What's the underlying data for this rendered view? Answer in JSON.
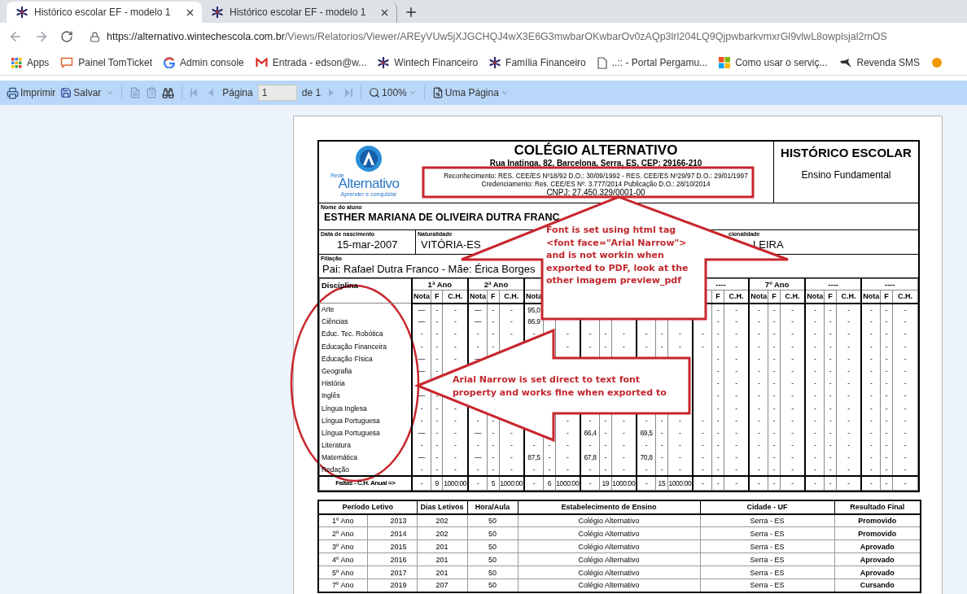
{
  "browser": {
    "tabs": [
      {
        "title": "Histórico escolar EF - modelo 1",
        "selected": true
      },
      {
        "title": "Histórico escolar EF - modelo 1",
        "selected": false
      }
    ],
    "url_host": "https://alternativo.wintechescola.com.br",
    "url_path": "/Views/Relatorios/Viewer/AREyVUw5jXJGCHQJ4wX3E6G3mwbarOKwbarOv0zAQp3lrl204LQ9QjpwbarkvmxrGl9vlwL8owplsjal2mOS",
    "bookmarks": [
      {
        "kind": "grid",
        "label": "Apps"
      },
      {
        "kind": "bubble",
        "label": "Painel TomTicket"
      },
      {
        "kind": "ring",
        "label": "Admin console"
      },
      {
        "kind": "envelope",
        "label": "Entrada - edson@w..."
      },
      {
        "kind": "asterisk",
        "label": "Wintech Financeiro"
      },
      {
        "kind": "asterisk",
        "label": "Família Financeiro"
      },
      {
        "kind": "document",
        "label": "..:: - Portal Pergamu..."
      },
      {
        "kind": "squares",
        "label": "Como usar o serviç..."
      },
      {
        "kind": "bird",
        "label": "Revenda SMS"
      },
      {
        "kind": "circle"
      }
    ]
  },
  "toolbar": {
    "print": "Imprimir",
    "save": "Salvar",
    "page_label": "Página",
    "page_value": "1",
    "page_of": "de 1",
    "zoom": "100%",
    "view": "Uma Página",
    "navigation_disabled": true
  },
  "report": {
    "logo": {
      "small": "Rede",
      "name": "Alternativo",
      "tagline": "Aprender e conquistar"
    },
    "school": "COLÉGIO ALTERNATIVO",
    "address": "Rua Inatinga, 82, Barcelona, Serra, ES, CEP: 29166-210",
    "recognition": "Reconhecimento: RES. CEE/ES Nº18/92 D.O.: 30/09/1992 - RES. CEE/ES Nº29/97 D.O.: 29/01/1997",
    "accreditation": "Credenciamento: Res. CEE/ES Nº. 3.777/2014 Publicação D.O.: 28/10/2014",
    "cnpj": "CNPJ: 27.450.329/0001-00",
    "doc_title": "HISTÓRICO ESCOLAR",
    "doc_subtitle": "Ensino Fundamental",
    "student": {
      "label": "Nome do aluno",
      "value": "ESTHER MARIANA DE OLIVEIRA DUTRA FRANC"
    },
    "birth": {
      "label": "Data de nascimento",
      "value": "15-mar-2007"
    },
    "birthplace": {
      "label": "Naturalidade",
      "value": "VITÓRIA-ES"
    },
    "nationality": {
      "label": "cionalidade",
      "value": "LEIRA"
    },
    "parents": {
      "label": "Filiação",
      "value": "Pai: Rafael Dutra Franco - Mãe: Érica Borges"
    }
  },
  "grades": {
    "subject_header": "Disciplina",
    "groups": [
      {
        "kind": "year",
        "title": "1ª Ano",
        "subheaders": {
          "nota": "Nota",
          "f": "F",
          "ch": "C.H."
        }
      },
      {
        "kind": "year",
        "title": "2ª Ano",
        "subheaders": {
          "nota": "Nota",
          "f": "F",
          "ch": "C.H."
        }
      },
      {
        "kind": "year",
        "subheaders": {
          "nota": "Nota"
        }
      },
      {
        "kind": "covered"
      },
      {
        "kind": "covered"
      },
      {
        "kind": "year",
        "title": "----",
        "subheaders": {
          "f": "F",
          "ch": "C.H."
        }
      },
      {
        "kind": "year",
        "title": "7º Ano",
        "subheaders": {
          "nota": "Nota",
          "f": "F",
          "ch": "C.H."
        }
      },
      {
        "kind": "year",
        "title": "----",
        "subheaders": {
          "nota": "Nota",
          "f": "F",
          "ch": "C.H."
        }
      },
      {
        "kind": "year",
        "title": "----",
        "subheaders": {
          "nota": "Nota",
          "f": "F",
          "ch": "C.H."
        }
      }
    ],
    "rows": [
      {
        "subject": "Arte",
        "cells": [
          {
            "text": "—"
          },
          {
            "text": "-"
          },
          {
            "text": "-"
          },
          {
            "text": "—"
          },
          {
            "text": "-"
          },
          {
            "text": "-"
          },
          {
            "text": "95,0"
          },
          {},
          {},
          {},
          {},
          {},
          {},
          {},
          {},
          {},
          {
            "text": "-"
          },
          {
            "text": "-"
          },
          {
            "text": "-"
          },
          {
            "text": "-"
          },
          {
            "text": "-"
          },
          {
            "text": "-"
          },
          {
            "text": "-"
          },
          {
            "text": "-"
          },
          {
            "text": "-"
          },
          {
            "text": "-"
          },
          {
            "text": "-"
          }
        ]
      },
      {
        "subject": "Ciências",
        "cells": [
          {
            "text": "—"
          },
          {
            "text": "-"
          },
          {
            "text": "-"
          },
          {
            "text": "—"
          },
          {
            "text": "-"
          },
          {
            "text": "-"
          },
          {
            "text": "86,9"
          },
          {},
          {},
          {},
          {},
          {},
          {},
          {},
          {},
          {},
          {
            "text": "-"
          },
          {
            "text": "-"
          },
          {
            "text": "-"
          },
          {
            "text": "-"
          },
          {
            "text": "-"
          },
          {
            "text": "-"
          },
          {
            "text": "-"
          },
          {
            "text": "-"
          },
          {
            "text": "-"
          },
          {
            "text": "-"
          },
          {
            "text": "-"
          }
        ]
      },
      {
        "subject": "Educ. Tec. Robótica",
        "cells": [
          {
            "text": "-"
          },
          {
            "text": "-"
          },
          {
            "text": "-"
          },
          {
            "text": "-"
          },
          {
            "text": "-"
          },
          {
            "text": "-"
          },
          {
            "text": "-"
          },
          {},
          {
            "text": "-"
          },
          {
            "text": "-"
          },
          {
            "text": "-"
          },
          {
            "text": "-"
          },
          {
            "text": "-"
          },
          {
            "text": "-"
          },
          {
            "text": "-"
          },
          {
            "text": "-"
          },
          {
            "text": "-"
          },
          {
            "text": "-"
          },
          {
            "text": "-"
          },
          {
            "text": "-"
          },
          {
            "text": "-"
          },
          {
            "text": "-"
          },
          {
            "text": "-"
          },
          {
            "text": "-"
          },
          {
            "text": "-"
          },
          {
            "text": "-"
          },
          {
            "text": "-"
          }
        ]
      },
      {
        "subject": "Educação Financeira",
        "cells": [
          {
            "text": "-"
          },
          {
            "text": "-"
          },
          {
            "text": "-"
          },
          {
            "text": "-"
          },
          {
            "text": "-"
          },
          {},
          {},
          {},
          {
            "text": "-"
          },
          {
            "text": "-"
          },
          {
            "text": "-"
          },
          {
            "text": "-"
          },
          {
            "text": "-"
          },
          {
            "text": "-"
          },
          {
            "text": "-"
          },
          {
            "text": "-"
          },
          {
            "text": "-"
          },
          {
            "text": "-"
          },
          {
            "text": "-"
          },
          {
            "text": "-"
          },
          {
            "text": "-"
          },
          {
            "text": "-"
          },
          {
            "text": "-"
          },
          {
            "text": "-"
          },
          {
            "text": "-"
          },
          {
            "text": "-"
          },
          {
            "text": "-"
          }
        ]
      },
      {
        "subject": "Educação Física",
        "cells": [
          {
            "text": "—"
          },
          {
            "text": "-"
          },
          {
            "text": "-"
          },
          {
            "text": "—"
          },
          {},
          {},
          {},
          {},
          {},
          {},
          {},
          {},
          {},
          {},
          {},
          {},
          {
            "text": "-"
          },
          {
            "text": "-"
          },
          {
            "text": "-"
          },
          {
            "text": "-"
          },
          {
            "text": "-"
          },
          {
            "text": "-"
          },
          {
            "text": "-"
          },
          {
            "text": "-"
          },
          {
            "text": "-"
          },
          {
            "text": "-"
          },
          {
            "text": "-"
          }
        ]
      },
      {
        "subject": "Geografia",
        "cells": [
          {
            "text": "—"
          },
          {
            "text": "-"
          },
          {},
          {},
          {},
          {},
          {},
          {},
          {},
          {},
          {},
          {},
          {},
          {},
          {},
          {},
          {
            "text": "-"
          },
          {
            "text": "-"
          },
          {
            "text": "-"
          },
          {
            "text": "-"
          },
          {
            "text": "-"
          },
          {
            "text": "-"
          },
          {
            "text": "-"
          },
          {
            "text": "-"
          },
          {
            "text": "-"
          },
          {
            "text": "-"
          },
          {
            "text": "-"
          }
        ]
      },
      {
        "subject": "História",
        "cells": [
          {},
          {},
          {},
          {},
          {},
          {},
          {},
          {},
          {},
          {},
          {},
          {},
          {},
          {},
          {},
          {},
          {
            "text": "-"
          },
          {
            "text": "-"
          },
          {
            "text": "-"
          },
          {
            "text": "-"
          },
          {
            "text": "-"
          },
          {
            "text": "-"
          },
          {
            "text": "-"
          },
          {
            "text": "-"
          },
          {
            "text": "-"
          },
          {
            "text": "-"
          },
          {
            "text": "-"
          }
        ]
      },
      {
        "subject": "Inglês",
        "cells": [
          {
            "text": "—"
          },
          {
            "text": "-"
          },
          {},
          {},
          {},
          {},
          {},
          {},
          {},
          {},
          {},
          {},
          {},
          {},
          {},
          {},
          {
            "text": "-"
          },
          {
            "text": "-"
          },
          {
            "text": "-"
          },
          {
            "text": "-"
          },
          {
            "text": "-"
          },
          {
            "text": "-"
          },
          {
            "text": "-"
          },
          {
            "text": "-"
          },
          {
            "text": "-"
          },
          {
            "text": "-"
          },
          {
            "text": "-"
          }
        ]
      },
      {
        "subject": "Língua Inglesa",
        "cells": [
          {
            "text": "-"
          },
          {
            "text": "-"
          },
          {
            "text": "-"
          },
          {},
          {},
          {},
          {},
          {},
          {},
          {},
          {},
          {},
          {},
          {},
          {},
          {},
          {
            "text": "-"
          },
          {
            "text": "-"
          },
          {
            "text": "-"
          },
          {
            "text": "-"
          },
          {
            "text": "-"
          },
          {
            "text": "-"
          },
          {
            "text": "-"
          },
          {
            "text": "-"
          },
          {
            "text": "-"
          },
          {
            "text": "-"
          },
          {
            "text": "-"
          }
        ]
      },
      {
        "subject": "Língua Portuguesa",
        "cells": [
          {
            "text": "-"
          },
          {
            "text": "-"
          },
          {
            "text": "-"
          },
          {
            "text": "-"
          },
          {
            "text": "-"
          },
          {},
          {},
          {},
          {
            "text": "-"
          },
          {
            "text": "-"
          },
          {
            "text": "-"
          },
          {
            "text": "-"
          },
          {
            "text": "-"
          },
          {
            "text": "-"
          },
          {
            "text": "-"
          },
          {
            "text": "-"
          },
          {
            "text": "-"
          },
          {
            "text": "-"
          },
          {
            "text": "-"
          },
          {
            "text": "-"
          },
          {
            "text": "-"
          },
          {
            "text": "-"
          },
          {
            "text": "-"
          },
          {
            "text": "-"
          },
          {
            "text": "-"
          },
          {
            "text": "-"
          },
          {
            "text": "-"
          }
        ]
      },
      {
        "subject": "Língua Portuguesa",
        "cells": [
          {
            "text": "—"
          },
          {
            "text": "-"
          },
          {
            "text": "-"
          },
          {
            "text": "—"
          },
          {
            "text": "-"
          },
          {
            "text": "-"
          },
          {},
          {},
          {
            "text": "-"
          },
          {
            "text": "66,4"
          },
          {
            "text": "-"
          },
          {
            "text": "-"
          },
          {
            "text": "69,5"
          },
          {
            "text": "-"
          },
          {
            "text": "-"
          },
          {
            "text": "-"
          },
          {
            "text": "-"
          },
          {
            "text": "-"
          },
          {
            "text": "-"
          },
          {
            "text": "-"
          },
          {
            "text": "-"
          },
          {
            "text": "-"
          },
          {
            "text": "-"
          },
          {
            "text": "-"
          },
          {
            "text": "-"
          },
          {
            "text": "-"
          },
          {
            "text": "-"
          }
        ]
      },
      {
        "subject": "Literatura",
        "cells": [
          {
            "text": "-"
          },
          {
            "text": "-"
          },
          {
            "text": "-"
          },
          {
            "text": "-"
          },
          {
            "text": "-"
          },
          {
            "text": "-"
          },
          {
            "text": "-"
          },
          {
            "text": "-"
          },
          {
            "text": "-"
          },
          {
            "text": "-"
          },
          {
            "text": "-"
          },
          {
            "text": "-"
          },
          {
            "text": "-"
          },
          {
            "text": "-"
          },
          {
            "text": "-"
          },
          {
            "text": "-"
          },
          {
            "text": "-"
          },
          {
            "text": "-"
          },
          {
            "text": "-"
          },
          {
            "text": "-"
          },
          {
            "text": "-"
          },
          {
            "text": "-"
          },
          {
            "text": "-"
          },
          {
            "text": "-"
          },
          {
            "text": "-"
          },
          {
            "text": "-"
          },
          {
            "text": "-"
          }
        ]
      },
      {
        "subject": "Matemática",
        "cells": [
          {
            "text": "—"
          },
          {
            "text": "-"
          },
          {
            "text": "-"
          },
          {
            "text": "—"
          },
          {
            "text": "-"
          },
          {
            "text": "-"
          },
          {
            "text": "87,5"
          },
          {
            "text": "-"
          },
          {
            "text": "-"
          },
          {
            "text": "67,8"
          },
          {
            "text": "-"
          },
          {
            "text": "-"
          },
          {
            "text": "70,8"
          },
          {
            "text": "-"
          },
          {
            "text": "-"
          },
          {
            "text": "-"
          },
          {
            "text": "-"
          },
          {
            "text": "-"
          },
          {
            "text": "-"
          },
          {
            "text": "-"
          },
          {
            "text": "-"
          },
          {
            "text": "-"
          },
          {
            "text": "-"
          },
          {
            "text": "-"
          },
          {
            "text": "-"
          },
          {
            "text": "-"
          },
          {
            "text": "-"
          }
        ]
      },
      {
        "subject": "Redação",
        "cells": [
          {
            "text": "-"
          },
          {
            "text": "-"
          },
          {
            "text": "-"
          },
          {
            "text": "-"
          },
          {
            "text": "-"
          },
          {
            "text": "-"
          },
          {
            "text": "-"
          },
          {
            "text": "-"
          },
          {
            "text": "-"
          },
          {
            "text": "-"
          },
          {
            "text": "-"
          },
          {
            "text": "-"
          },
          {
            "text": "-"
          },
          {
            "text": "-"
          },
          {
            "text": "-"
          },
          {
            "text": "-"
          },
          {
            "text": "-"
          },
          {
            "text": "-"
          },
          {
            "text": "-"
          },
          {
            "text": "-"
          },
          {
            "text": "-"
          },
          {
            "text": "-"
          },
          {
            "text": "-"
          },
          {
            "text": "-"
          },
          {
            "text": "-"
          },
          {
            "text": "-"
          },
          {
            "text": "-"
          }
        ]
      }
    ],
    "totals": {
      "label": "Faltas - C.H. Anual =>",
      "cells": [
        "-",
        "9",
        "1000:00",
        "-",
        "5",
        "1000:00",
        "-",
        "6",
        "1000:00",
        "-",
        "19",
        "1000:00",
        "-",
        "15",
        "1000:00",
        "-",
        "-",
        "-",
        "-",
        "-",
        "-",
        "-",
        "-",
        "-",
        "-",
        "-",
        "-"
      ]
    }
  },
  "periods": {
    "columns": [
      "Período Letivo",
      "Dias Letivos",
      "Hora/Aula",
      "Estabelecimento de Ensino",
      "Cidade - UF",
      "Resultado Final"
    ],
    "rows": [
      [
        [
          "1º Ano",
          "2013"
        ],
        "202",
        "50",
        "Colégio Alternativo",
        "Serra - ES",
        "Promovido"
      ],
      [
        [
          "2º Ano",
          "2014"
        ],
        "202",
        "50",
        "Colégio Alternativo",
        "Serra - ES",
        "Promovido"
      ],
      [
        [
          "3º Ano",
          "2015"
        ],
        "201",
        "50",
        "Colégio Alternativo",
        "Serra - ES",
        "Aprovado"
      ],
      [
        [
          "4º Ano",
          "2016"
        ],
        "201",
        "50",
        "Colégio Alternativo",
        "Serra - ES",
        "Aprovado"
      ],
      [
        [
          "5º Ano",
          "2017"
        ],
        "201",
        "50",
        "Colégio Alternativo",
        "Serra - ES",
        "Aprovado"
      ],
      [
        [
          "7º Ano",
          "2019"
        ],
        "207",
        "50",
        "Colégio Alternativo",
        "Serra - ES",
        "Cursando"
      ]
    ]
  },
  "annotations": [
    {
      "kind": "up_arrow",
      "text": "Font is set using html tag\n<font face=\"Arial Narrow\">\nand is not workin when\nexported to PDF, look at the\nother imagem preview_pdf"
    },
    {
      "kind": "left_arrow",
      "text": "Arial Narrow is set direct to text font\nproperty and works fine when exported to"
    },
    {
      "kind": "ellipse"
    },
    {
      "kind": "frame"
    }
  ]
}
